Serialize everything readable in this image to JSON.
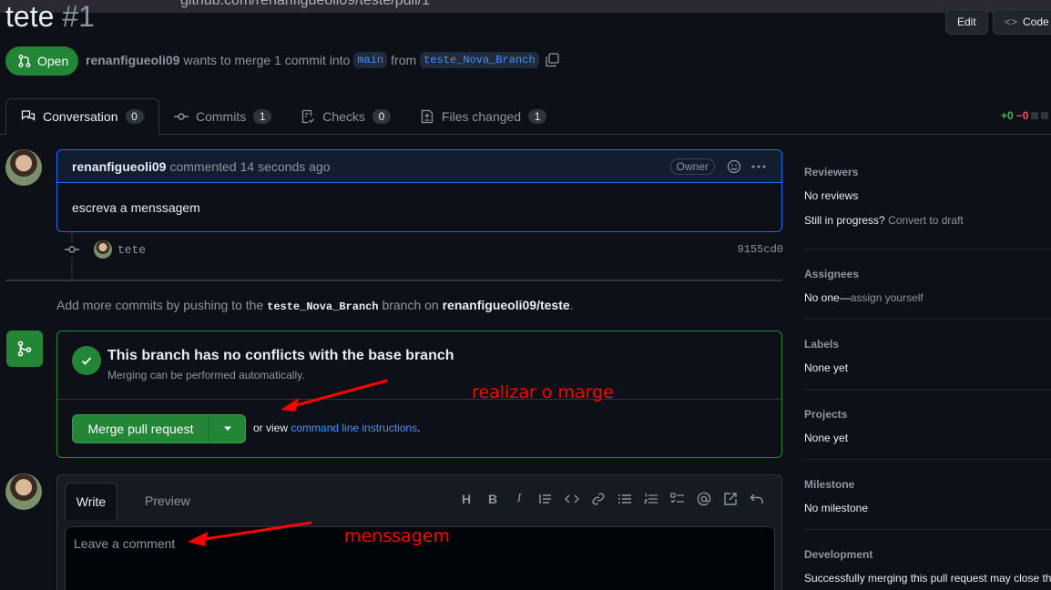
{
  "browser": {
    "url_host": "github.com",
    "url_path": "/renanfigueoli09/teste/pull/1"
  },
  "header": {
    "title": "tete",
    "number": "#1",
    "edit_label": "Edit",
    "code_label": "Code"
  },
  "pr": {
    "state": "Open",
    "author": "renanfigueoli09",
    "summary": "wants to merge 1 commit into",
    "base": "main",
    "from_word": "from",
    "head": "teste_Nova_Branch"
  },
  "tabs": [
    {
      "label": "Conversation",
      "count": "0"
    },
    {
      "label": "Commits",
      "count": "1"
    },
    {
      "label": "Checks",
      "count": "0"
    },
    {
      "label": "Files changed",
      "count": "1"
    }
  ],
  "diffstat": {
    "plus": "+0",
    "minus": "−0"
  },
  "comment": {
    "author": "renanfigueoli09",
    "action": "commented",
    "time": "14 seconds ago",
    "role": "Owner",
    "body": "escreva a menssagem"
  },
  "commit": {
    "message": "tete",
    "sha": "9155cd0"
  },
  "add_more": {
    "prefix": "Add more commits by pushing to the",
    "branch": "teste_Nova_Branch",
    "middle": "branch on",
    "repo": "renanfigueoli09/teste",
    "suffix": "."
  },
  "merge": {
    "title": "This branch has no conflicts with the base branch",
    "subtitle": "Merging can be performed automatically.",
    "button": "Merge pull request",
    "or_view": "or view",
    "cli_link": "command line instructions",
    "period": "."
  },
  "composer": {
    "write_tab": "Write",
    "preview_tab": "Preview",
    "placeholder": "Leave a comment"
  },
  "sidebar": {
    "reviewers": {
      "heading": "Reviewers",
      "value": "No reviews",
      "progress": "Still in progress?",
      "draft_link": "Convert to draft"
    },
    "assignees": {
      "heading": "Assignees",
      "value": "No one—",
      "assign_link": "assign yourself"
    },
    "labels": {
      "heading": "Labels",
      "value": "None yet"
    },
    "projects": {
      "heading": "Projects",
      "value": "None yet"
    },
    "milestone": {
      "heading": "Milestone",
      "value": "No milestone"
    },
    "development": {
      "heading": "Development",
      "value": "Successfully merging this pull request may close th"
    }
  },
  "annotations": {
    "merge_note": "realizar o marge",
    "message_note": "menssagem"
  },
  "colors": {
    "open_green": "#238636",
    "link_blue": "#4493f8",
    "annotation_red": "#ff0000",
    "active_border": "#1f6feb"
  }
}
